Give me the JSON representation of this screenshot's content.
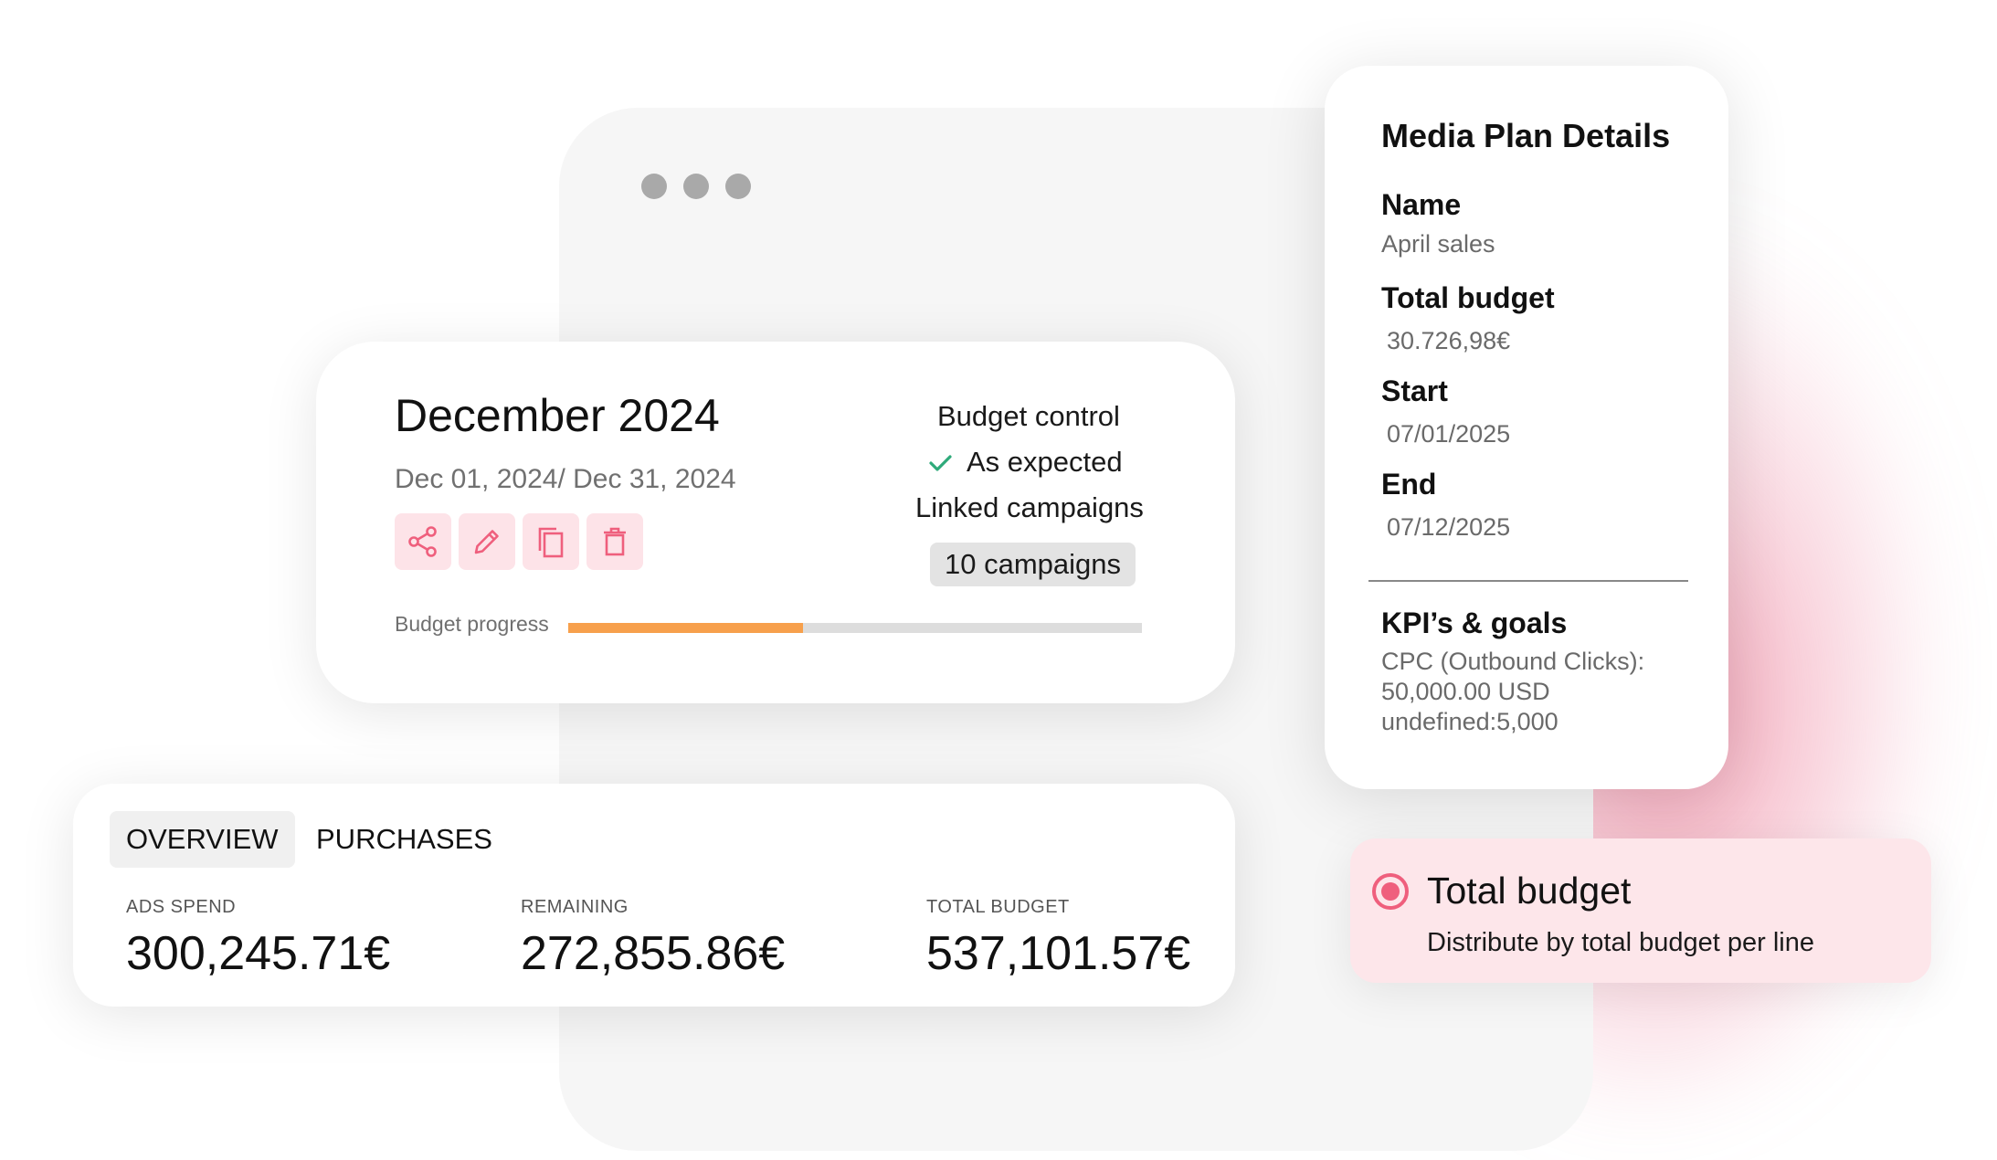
{
  "colors": {
    "accent_pink": "#ef5f7d",
    "action_bg": "#fde3e8",
    "progress_fill": "#f7a04c",
    "progress_track": "#dddddd",
    "check_green": "#2eaa7a"
  },
  "plan_card": {
    "title": "December 2024",
    "date_range": "Dec 01, 2024/ Dec 31, 2024",
    "actions": [
      {
        "label": "share",
        "icon": "share-icon"
      },
      {
        "label": "edit",
        "icon": "pencil-icon"
      },
      {
        "label": "duplicate",
        "icon": "copy-icon"
      },
      {
        "label": "delete",
        "icon": "trash-icon"
      }
    ],
    "budget_control_label": "Budget control",
    "budget_control_status": "As expected",
    "linked_campaigns_label": "Linked campaigns",
    "linked_campaigns_badge": "10 campaigns",
    "budget_progress_label": "Budget progress",
    "budget_progress_fraction": 0.41
  },
  "overview": {
    "tabs": [
      {
        "label": "OVERVIEW",
        "active": true
      },
      {
        "label": "PURCHASES",
        "active": false
      }
    ],
    "stats": [
      {
        "label": "ADS SPEND",
        "value": "300,245.71€"
      },
      {
        "label": "REMAINING",
        "value": "272,855.86€"
      },
      {
        "label": "TOTAL BUDGET",
        "value": "537,101.57€"
      }
    ]
  },
  "details": {
    "title": "Media Plan Details",
    "fields": [
      {
        "key": "Name",
        "value": "April sales"
      },
      {
        "key": "Total budget",
        "value": "30.726,98€"
      },
      {
        "key": "Start",
        "value": "07/01/2025"
      },
      {
        "key": "End",
        "value": "07/12/2025"
      }
    ],
    "kpi_title": "KPI’s & goals",
    "kpi_lines": [
      "CPC (Outbound Clicks):",
      "50,000.00 USD",
      "undefined:5,000"
    ]
  },
  "budget_option": {
    "title": "Total budget",
    "description": "Distribute by total budget per line",
    "selected": true
  }
}
